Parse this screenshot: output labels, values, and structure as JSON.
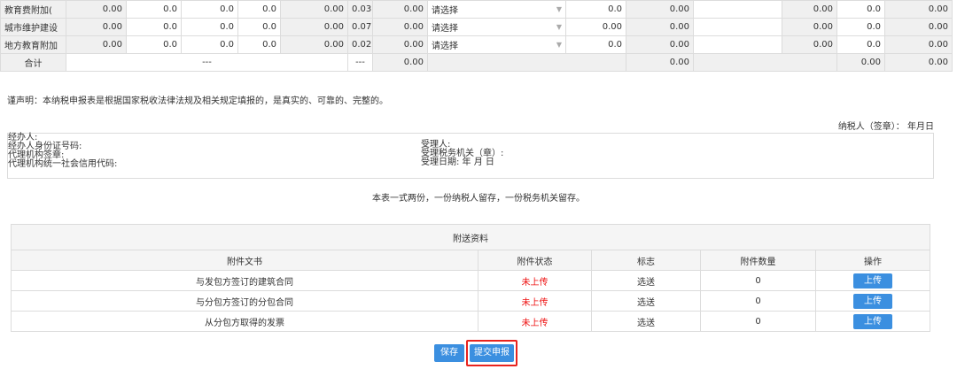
{
  "tax_rows": [
    {
      "name": "教育费附加(",
      "v1": "0.00",
      "v2": "0.0",
      "v3": "0.0",
      "v4": "0.0",
      "v5": "0.00",
      "rate": "0.03",
      "v6": "0.00",
      "select": "请选择",
      "v7": "0.0",
      "v8": "0.00",
      "v9": "",
      "v10": "0.00",
      "v11": "0.0",
      "v12": "0.00"
    },
    {
      "name": "城市维护建设",
      "v1": "0.00",
      "v2": "0.0",
      "v3": "0.0",
      "v4": "0.0",
      "v5": "0.00",
      "rate": "0.07",
      "v6": "0.00",
      "select": "请选择",
      "v7": "0.00",
      "v8": "0.00",
      "v9": "",
      "v10": "0.00",
      "v11": "0.0",
      "v12": "0.00"
    },
    {
      "name": "地方教育附加",
      "v1": "0.00",
      "v2": "0.0",
      "v3": "0.0",
      "v4": "0.0",
      "v5": "0.00",
      "rate": "0.02",
      "v6": "0.00",
      "select": "请选择",
      "v7": "0.0",
      "v8": "0.00",
      "v9": "",
      "v10": "0.00",
      "v11": "0.0",
      "v12": "0.00"
    }
  ],
  "total_row": {
    "label": "合计",
    "dash1": "---",
    "dash2": "---",
    "v6": "0.00",
    "v8": "0.00",
    "v11": "0.00",
    "v12": "0.00"
  },
  "declaration": "谨声明：本纳税申报表是根据国家税收法律法规及相关规定填报的，是真实的、可靠的、完整的。",
  "taxpayer_sign": "纳税人（签章）： 年月日",
  "agent": {
    "handler": "经办人:",
    "handler_id": "经办人身份证号码:",
    "agency_seal": "代理机构签章:",
    "agency_credit": "代理机构统一社会信用代码:"
  },
  "receiver": {
    "receiver": "受理人:",
    "tax_office": "受理税务机关（章）:",
    "date": "受理日期: 年 月 日"
  },
  "copies_note": "本表一式两份，一份纳税人留存，一份税务机关留存。",
  "attachments": {
    "title": "附送资料",
    "headers": {
      "doc": "附件文书",
      "status": "附件状态",
      "flag": "标志",
      "count": "附件数量",
      "op": "操作"
    },
    "rows": [
      {
        "doc": "与发包方签订的建筑合同",
        "status": "未上传",
        "flag": "选送",
        "count": "0",
        "op": "上传"
      },
      {
        "doc": "与分包方签订的分包合同",
        "status": "未上传",
        "flag": "选送",
        "count": "0",
        "op": "上传"
      },
      {
        "doc": "从分包方取得的发票",
        "status": "未上传",
        "flag": "选送",
        "count": "0",
        "op": "上传"
      }
    ]
  },
  "buttons": {
    "save": "保存",
    "submit": "提交申报"
  },
  "colors": {
    "primary": "#3b8fe0",
    "status_red": "#ee1111",
    "highlight": "#e8231e"
  }
}
